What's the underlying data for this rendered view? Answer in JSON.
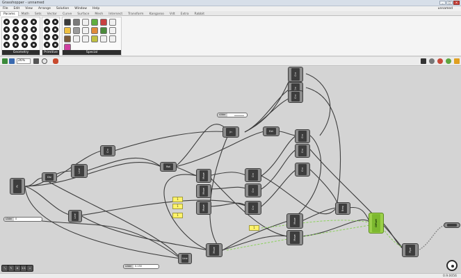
{
  "window": {
    "title": "Grasshopper - unnamed",
    "min": "_",
    "max": "□",
    "close": "✕"
  },
  "menu": {
    "items": [
      "File",
      "Edit",
      "View",
      "Arrange",
      "Solution",
      "Window",
      "Help"
    ],
    "document": "unnamed"
  },
  "tabs": {
    "items": [
      "Params",
      "Math",
      "Sets",
      "Vector",
      "Curve",
      "Surface",
      "Mesh",
      "Intersect",
      "Transform",
      "Kangaroo",
      "Vdt",
      "Extra",
      "Rabbit"
    ],
    "active": 0
  },
  "ribbon": {
    "panel_geometry": "Geometry",
    "panel_primitive": "Primitive",
    "panel_special": "Special"
  },
  "toolbar": {
    "zoom": "26%"
  },
  "canvas": {
    "panels": [
      "1",
      "1",
      "1",
      "1"
    ],
    "slider_left": {
      "label": "slider",
      "value": "0"
    },
    "slider_bottom": {
      "label": "slider",
      "value": "0.150"
    },
    "top_slider": {
      "label": "slider",
      "value": ""
    },
    "node_labels": {
      "pt": "Pt",
      "div": "Div",
      "line": "Line",
      "crv": "Crv",
      "move": "Move",
      "rot": "Rot",
      "jn": "Jn",
      "ext": "Ext",
      "pipe": "Pipe",
      "brep": "Brep",
      "offset": "Offset"
    }
  },
  "dock": {
    "items": [
      "⤡",
      "✎",
      "A",
      "1:1",
      "⟂"
    ]
  },
  "status": {
    "version": "0.9.0056"
  }
}
